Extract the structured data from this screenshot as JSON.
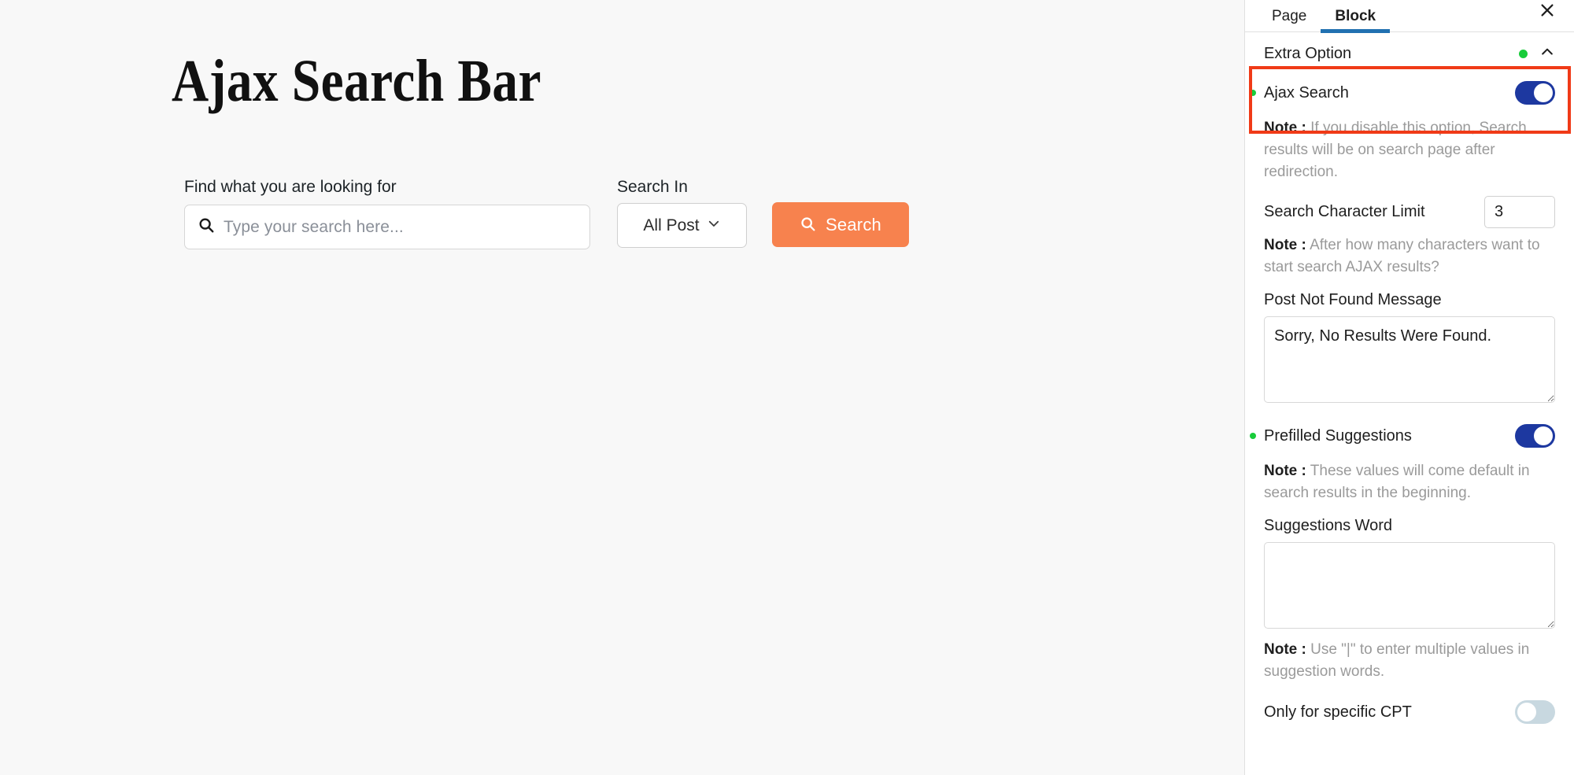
{
  "page": {
    "title": "Ajax Search Bar"
  },
  "search_widget": {
    "find_label": "Find what you are looking for",
    "search_placeholder": "Type your search here...",
    "search_value": "",
    "search_in_label": "Search In",
    "post_type_selected": "All Post",
    "search_button_label": "Search",
    "search_button_color": "#f7824e",
    "search_icon": "search-icon",
    "chevron_icon": "chevron-down-icon"
  },
  "panel": {
    "tabs": [
      {
        "label": "Page",
        "active": false
      },
      {
        "label": "Block",
        "active": true
      }
    ],
    "active_tab_color": "#2171b1",
    "close_icon": "close-icon",
    "section": {
      "title": "Extra Option",
      "status_dot_color": "#18cc3a",
      "collapse_icon": "chevron-up-icon",
      "expanded": true
    },
    "highlight_color": "#f03a17",
    "settings": {
      "ajax_search": {
        "label": "Ajax Search",
        "enabled": true,
        "note_prefix": "Note :",
        "note": "If you disable this option, Search results will be on search page after redirection."
      },
      "search_character_limit": {
        "label": "Search Character Limit",
        "value": "3",
        "note_prefix": "Note :",
        "note": "After how many characters want to start search AJAX results?"
      },
      "post_not_found_message": {
        "label": "Post Not Found Message",
        "value": "Sorry, No Results Were Found."
      },
      "prefilled_suggestions": {
        "label": "Prefilled Suggestions",
        "enabled": true,
        "note_prefix": "Note :",
        "note": "These values will come default in search results in the beginning."
      },
      "suggestions_word": {
        "label": "Suggestions Word",
        "value": "",
        "note_prefix": "Note :",
        "note": "Use \"|\" to enter multiple values in suggestion words."
      },
      "only_for_specific_cpt": {
        "label": "Only for specific CPT",
        "enabled": false
      }
    },
    "toggle_on_color": "#1d38a0",
    "toggle_off_color": "#c8d8e0"
  }
}
